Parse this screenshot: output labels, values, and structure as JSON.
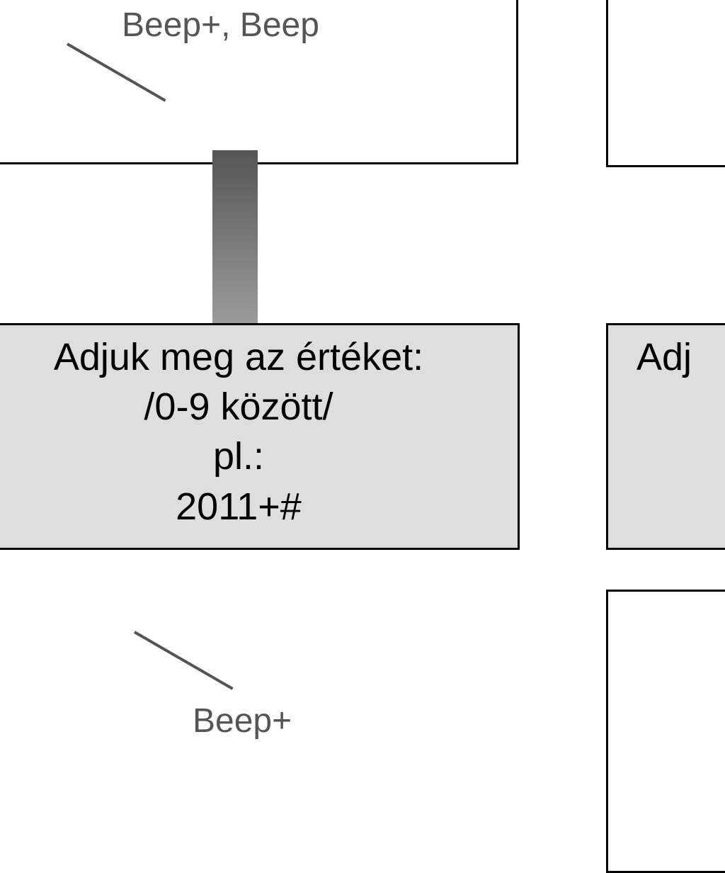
{
  "top": {
    "label": "Beep+, Beep"
  },
  "main": {
    "line1": "Adjuk meg az értéket:",
    "line2": "/0-9 között/",
    "line3": "pl.:",
    "line4": "2011+#"
  },
  "right": {
    "label_fragment": "Adj"
  },
  "bottom": {
    "label_fragment": "Beep+"
  }
}
